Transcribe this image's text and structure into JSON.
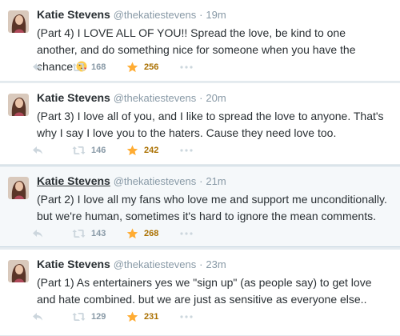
{
  "tweets": [
    {
      "name": "Katie Stevens",
      "handle": "@thekatiestevens",
      "separator": "·",
      "time": "19m",
      "text": "(Part 4) I LOVE ALL OF YOU!! Spread the love, be kind to one another, and do something nice for someone when you have the chance",
      "emoji": "face-throwing-kiss-icon",
      "retweets": "168",
      "favorites": "256"
    },
    {
      "name": "Katie Stevens",
      "handle": "@thekatiestevens",
      "separator": "·",
      "time": "20m",
      "text": "(Part 3) I love all of you, and I like to spread the love to anyone. That's why I say I love you to the haters. Cause they need love too.",
      "retweets": "146",
      "favorites": "242"
    },
    {
      "name": "Katie Stevens",
      "handle": "@thekatiestevens",
      "separator": "·",
      "time": "21m",
      "text": "(Part 2) I love all my fans who love me and support me unconditionally. but we're human, sometimes it's hard to ignore the mean comments.",
      "retweets": "143",
      "favorites": "268"
    },
    {
      "name": "Katie Stevens",
      "handle": "@thekatiestevens",
      "separator": "·",
      "time": "23m",
      "text": "(Part 1) As entertainers yes we \"sign up\" (as people say) to get love and hate combined. but we are just as sensitive as everyone else..",
      "retweets": "129",
      "favorites": "231"
    }
  ],
  "colors": {
    "name": "#292f33",
    "muted": "#8899a6",
    "star": "#ffac33",
    "fav_count": "#aa7000",
    "highlight_bg": "#f5f8fa"
  }
}
